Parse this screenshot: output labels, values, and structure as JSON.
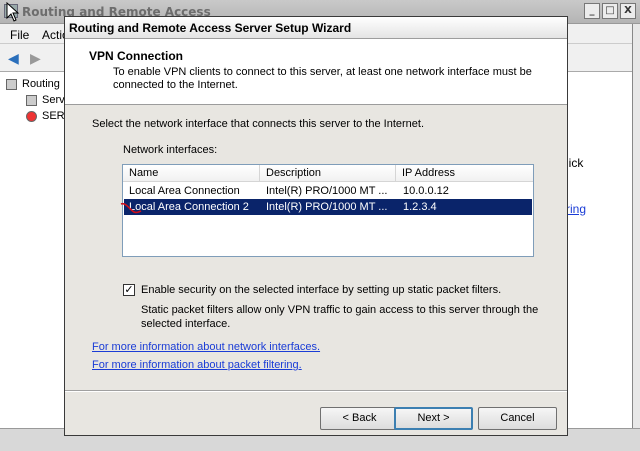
{
  "background_window": {
    "title": "Routing and Remote Access",
    "menu": [
      "File",
      "Actio"
    ],
    "tree": [
      "Routing",
      "Serv",
      "SER"
    ],
    "content_fragments": [
      "lick",
      "ring"
    ],
    "controls": [
      "_",
      "□",
      "X"
    ]
  },
  "dialog": {
    "title": "Routing and Remote Access Server Setup Wizard",
    "header_title": "VPN Connection",
    "header_subtitle": "To enable VPN clients to connect to this server, at least one network interface must be connected to the Internet.",
    "instruction": "Select the network interface that connects this server to the Internet.",
    "interfaces_label": "Network interfaces:",
    "columns": [
      "Name",
      "Description",
      "IP Address"
    ],
    "interfaces": [
      {
        "name": "Local Area Connection",
        "description": "Intel(R) PRO/1000 MT ...",
        "ip": "10.0.0.12",
        "selected": false
      },
      {
        "name": "Local Area Connection 2",
        "description": "Intel(R) PRO/1000 MT ...",
        "ip": "1.2.3.4",
        "selected": true
      }
    ],
    "security_checkbox": {
      "checked": true,
      "label": "Enable security on the selected interface by setting up static packet filters.",
      "description": "Static packet filters allow only VPN traffic to gain access to this server through the selected interface."
    },
    "links": [
      "For more information about network interfaces.",
      "For more information about packet filtering."
    ],
    "buttons": {
      "back": "< Back",
      "next": "Next >",
      "cancel": "Cancel"
    }
  }
}
